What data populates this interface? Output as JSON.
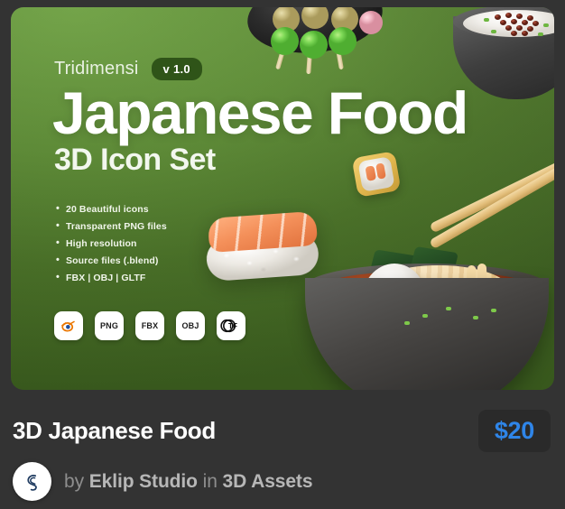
{
  "page": {
    "background_color": "#333333"
  },
  "preview_card": {
    "name": "japanese-food-icon-set-preview",
    "background_green_light": "#6c9f40",
    "background_green_dark": "#3e6220",
    "brand": "Tridimensi",
    "version": "v 1.0",
    "headline": "Japanese Food",
    "subheadline": "3D Icon Set",
    "features": [
      "20 Beautiful icons",
      "Transparent PNG files",
      "High resolution",
      "Source files (.blend)",
      "FBX | OBJ | GLTF"
    ],
    "format_badges": [
      {
        "icon": "blender-icon",
        "label": ""
      },
      {
        "icon": "png-badge",
        "label": "PNG"
      },
      {
        "icon": "fbx-badge",
        "label": "FBX"
      },
      {
        "icon": "obj-badge",
        "label": "OBJ"
      },
      {
        "icon": "gltf-icon",
        "label": "glTF"
      }
    ],
    "artwork": [
      "dango-skewers",
      "red-bean-rice-bowl",
      "salmon-maki-roll",
      "salmon-nigiri",
      "ramen-bowl-with-egg"
    ]
  },
  "meta": {
    "title": "3D Japanese Food",
    "price": "$20",
    "price_color": "#2f85e8",
    "by_label": "by",
    "author": "Eklip Studio",
    "in_label": "in",
    "category": "3D Assets",
    "avatar_icon": "eklip-studio-logo"
  }
}
